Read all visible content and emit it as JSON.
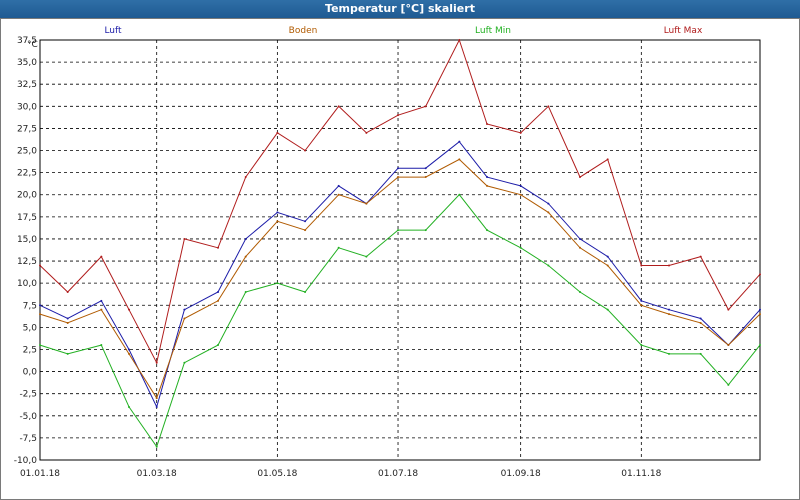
{
  "window": {
    "title": "Temperatur [°C] skaliert"
  },
  "chart_data": {
    "type": "line",
    "title": "Temperatur [°C] skaliert",
    "ylabel": "°C",
    "xlabel": "",
    "ylim": [
      -10,
      37.5
    ],
    "y_ticks": [
      "37,5",
      "35,0",
      "32,5",
      "30,0",
      "27,5",
      "25,0",
      "22,5",
      "20,0",
      "17,5",
      "15,0",
      "12,5",
      "10,0",
      "7,5",
      "5,0",
      "2,5",
      "0,0",
      "-2,5",
      "-5,0",
      "-7,5",
      "-10,0"
    ],
    "x_ticks": [
      "01.01.18",
      "01.03.18",
      "01.05.18",
      "01.07.18",
      "01.09.18",
      "01.11.18"
    ],
    "legend_position": "top",
    "grid": true,
    "series": [
      {
        "name": "Luft",
        "color": "#1c1ca8",
        "x": [
          "01.01.18",
          "15.01.18",
          "01.02.18",
          "15.02.18",
          "01.03.18",
          "15.03.18",
          "01.04.18",
          "15.04.18",
          "01.05.18",
          "15.05.18",
          "01.06.18",
          "15.06.18",
          "01.07.18",
          "15.07.18",
          "01.08.18",
          "15.08.18",
          "01.09.18",
          "15.09.18",
          "01.10.18",
          "15.10.18",
          "01.11.18",
          "15.11.18",
          "01.12.18",
          "15.12.18",
          "31.12.18"
        ],
        "values": [
          7.5,
          6,
          8,
          2.5,
          -4,
          7,
          9,
          15,
          18,
          17,
          21,
          19,
          23,
          23,
          26,
          22,
          21,
          19,
          15,
          13,
          8,
          7,
          6,
          3,
          7
        ]
      },
      {
        "name": "Boden",
        "color": "#b05a00",
        "x": [
          "01.01.18",
          "15.01.18",
          "01.02.18",
          "15.02.18",
          "01.03.18",
          "15.03.18",
          "01.04.18",
          "15.04.18",
          "01.05.18",
          "15.05.18",
          "01.06.18",
          "15.06.18",
          "01.07.18",
          "15.07.18",
          "01.08.18",
          "15.08.18",
          "01.09.18",
          "15.09.18",
          "01.10.18",
          "15.10.18",
          "01.11.18",
          "15.11.18",
          "01.12.18",
          "15.12.18",
          "31.12.18"
        ],
        "values": [
          6.5,
          5.5,
          7,
          2,
          -3,
          6,
          8,
          13,
          17,
          16,
          20,
          19,
          22,
          22,
          24,
          21,
          20,
          18,
          14,
          12,
          7.5,
          6.5,
          5.5,
          3,
          6.5
        ]
      },
      {
        "name": "Luft Min",
        "color": "#22b022",
        "x": [
          "01.01.18",
          "15.01.18",
          "01.02.18",
          "15.02.18",
          "01.03.18",
          "15.03.18",
          "01.04.18",
          "15.04.18",
          "01.05.18",
          "15.05.18",
          "01.06.18",
          "15.06.18",
          "01.07.18",
          "15.07.18",
          "01.08.18",
          "15.08.18",
          "01.09.18",
          "15.09.18",
          "01.10.18",
          "15.10.18",
          "01.11.18",
          "15.11.18",
          "01.12.18",
          "15.12.18",
          "31.12.18"
        ],
        "values": [
          3,
          2,
          3,
          -4,
          -8.5,
          1,
          3,
          9,
          10,
          9,
          14,
          13,
          16,
          16,
          20,
          16,
          14,
          12,
          9,
          7,
          3,
          2,
          2,
          -1.5,
          3
        ]
      },
      {
        "name": "Luft Max",
        "color": "#b01c1c",
        "x": [
          "01.01.18",
          "15.01.18",
          "01.02.18",
          "15.02.18",
          "01.03.18",
          "15.03.18",
          "01.04.18",
          "15.04.18",
          "01.05.18",
          "15.05.18",
          "01.06.18",
          "15.06.18",
          "01.07.18",
          "15.07.18",
          "01.08.18",
          "15.08.18",
          "01.09.18",
          "15.09.18",
          "01.10.18",
          "15.10.18",
          "01.11.18",
          "15.11.18",
          "01.12.18",
          "15.12.18",
          "31.12.18"
        ],
        "values": [
          12,
          9,
          13,
          7,
          1,
          15,
          14,
          22,
          27,
          25,
          30,
          27,
          29,
          30,
          37.5,
          28,
          27,
          30,
          22,
          24,
          12,
          12,
          13,
          7,
          11
        ]
      }
    ]
  }
}
